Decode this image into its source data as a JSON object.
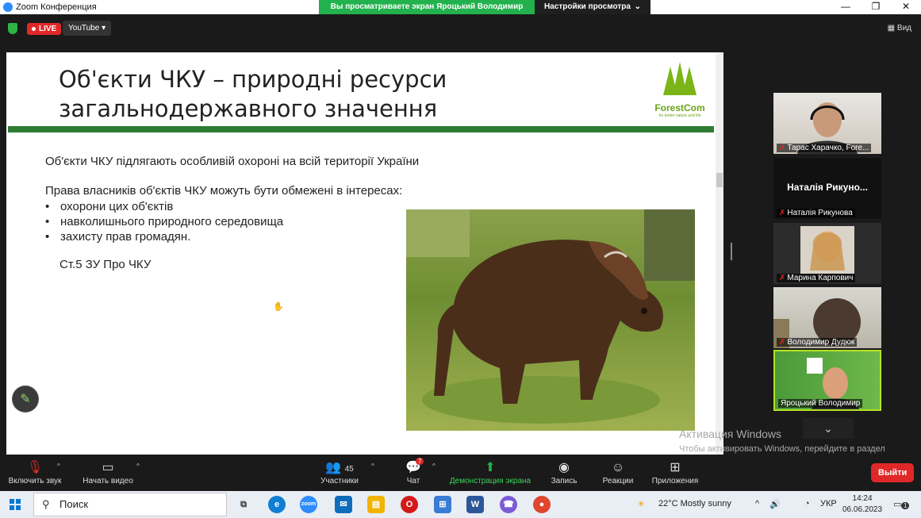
{
  "window": {
    "title": "Zoom Конференция",
    "share_message": "Вы просматриваете экран Ярoцький Володимир",
    "view_options": "Настройки просмотра"
  },
  "topbar": {
    "live": "LIVE",
    "stream": "YouTube",
    "view": "Вид"
  },
  "slide": {
    "title_line1": "Об'єкти ЧКУ –  природні ресурси",
    "title_line2": "загальнодержавного значення",
    "logo_brand": "ForestCom",
    "logo_tag": "for better nature and life",
    "paragraph1": "Об'єкти ЧКУ підлягають особливій охороні на всій території України",
    "paragraph2": "Права власників об'єктів ЧКУ можуть бути обмежені в інтересах:",
    "bullets": [
      "охорони цих об'єктів",
      "навколишнього природного середовища",
      "захисту прав громадян."
    ],
    "reference": "Ст.5 ЗУ Про ЧКУ"
  },
  "participants": [
    {
      "name": "Тарас Харачко, Fore..."
    },
    {
      "name": "Наталія Рикунова",
      "display": "Наталія  Рикуно..."
    },
    {
      "name": "Марина Карпович"
    },
    {
      "name": "Володимир Дудюк"
    },
    {
      "name": "Ярoцький Володимир"
    }
  ],
  "watermark": {
    "line1": "Активация Windows",
    "line2": "Чтобы активировать Windows, перейдите в раздел \"Параметры\"."
  },
  "toolbar": {
    "mute": "Включить звук",
    "video": "Начать видео",
    "participants": "Участники",
    "participants_count": "45",
    "chat": "Чат",
    "chat_badge": "7",
    "share": "Демонстрация экрана",
    "record": "Запись",
    "reactions": "Реакции",
    "apps": "Приложения",
    "leave": "Выйти"
  },
  "taskbar": {
    "search": "Поиск",
    "weather": "22°C  Mostly sunny",
    "lang": "УКР",
    "time": "14:24",
    "date": "06.06.2023",
    "notifications": "1"
  }
}
